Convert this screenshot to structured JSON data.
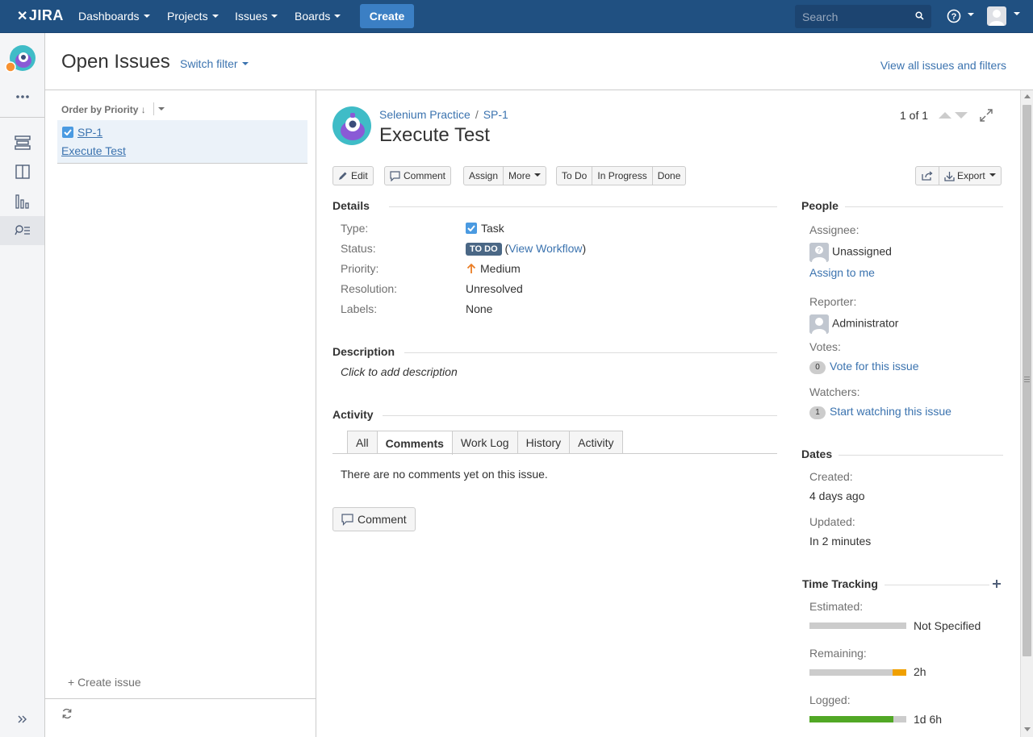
{
  "topnav": {
    "logo": "JIRA",
    "items": [
      {
        "label": "Dashboards"
      },
      {
        "label": "Projects"
      },
      {
        "label": "Issues"
      },
      {
        "label": "Boards"
      }
    ],
    "create_label": "Create",
    "search_placeholder": "Search"
  },
  "header": {
    "title": "Open Issues",
    "switch_filter": "Switch filter",
    "view_all": "View all issues and filters"
  },
  "list": {
    "order_by": "Order by Priority",
    "items": [
      {
        "key": "SP-1",
        "summary": "Execute Test"
      }
    ],
    "create_issue": "+ Create issue"
  },
  "issue": {
    "project": "Selenium Practice",
    "key": "SP-1",
    "title": "Execute Test",
    "pager": "1 of 1",
    "toolbar": {
      "edit": "Edit",
      "comment": "Comment",
      "assign": "Assign",
      "more": "More",
      "todo": "To Do",
      "in_progress": "In Progress",
      "done": "Done",
      "export": "Export"
    },
    "details": {
      "heading": "Details",
      "type_label": "Type:",
      "type_value": "Task",
      "status_label": "Status:",
      "status_value": "TO DO",
      "status_paren_open": "(",
      "view_workflow": "View Workflow",
      "status_paren_close": ")",
      "priority_label": "Priority:",
      "priority_value": "Medium",
      "resolution_label": "Resolution:",
      "resolution_value": "Unresolved",
      "labels_label": "Labels:",
      "labels_value": "None"
    },
    "description": {
      "heading": "Description",
      "placeholder": "Click to add description"
    },
    "activity": {
      "heading": "Activity",
      "tabs": [
        "All",
        "Comments",
        "Work Log",
        "History",
        "Activity"
      ],
      "active_tab": "Comments",
      "empty": "There are no comments yet on this issue.",
      "comment_button": "Comment"
    },
    "people": {
      "heading": "People",
      "assignee_label": "Assignee:",
      "assignee_value": "Unassigned",
      "assign_to_me": "Assign to me",
      "reporter_label": "Reporter:",
      "reporter_value": "Administrator",
      "votes_label": "Votes:",
      "votes_count": "0",
      "vote_link": "Vote for this issue",
      "watchers_label": "Watchers:",
      "watchers_count": "1",
      "watch_link": "Start watching this issue"
    },
    "dates": {
      "heading": "Dates",
      "created_label": "Created:",
      "created_value": "4 days ago",
      "updated_label": "Updated:",
      "updated_value": "In 2 minutes"
    },
    "time_tracking": {
      "heading": "Time Tracking",
      "estimated_label": "Estimated:",
      "estimated_value": "Not Specified",
      "remaining_label": "Remaining:",
      "remaining_value": "2h",
      "remaining_fraction": 0.14,
      "logged_label": "Logged:",
      "logged_value": "1d 6h",
      "logged_fraction": 0.87
    }
  },
  "colors": {
    "nav_bg": "#205081",
    "create_bg": "#3b7fc4",
    "link": "#3b73af",
    "status_todo": "#4a6785",
    "priority_medium": "#ea7d24",
    "remaining_bar": "#f0a000",
    "logged_bar": "#51a825"
  }
}
